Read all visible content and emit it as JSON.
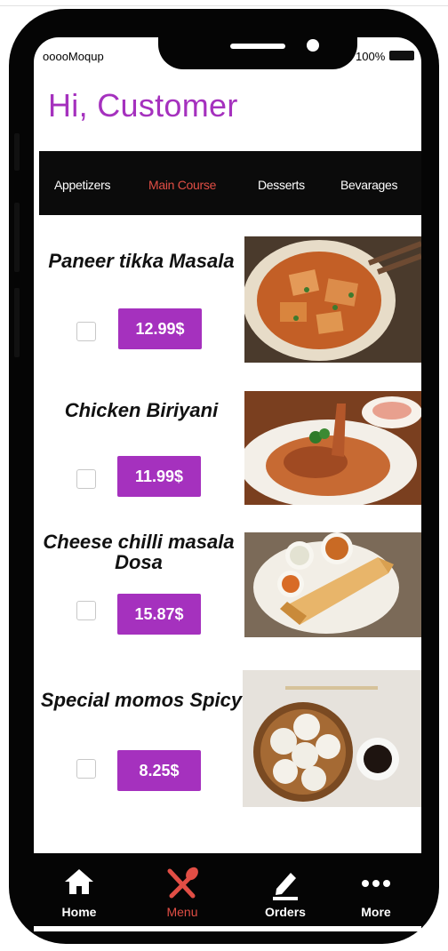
{
  "status_bar": {
    "carrier": "ooooMoqup",
    "battery": "100%"
  },
  "greeting": "Hi, Customer",
  "tabs": [
    {
      "label": "Appetizers",
      "active": false
    },
    {
      "label": "Main Course",
      "active": true
    },
    {
      "label": "Desserts",
      "active": false
    },
    {
      "label": "Bevarages",
      "active": false
    }
  ],
  "menu_items": [
    {
      "name": "Paneer tikka Masala",
      "price": "12.99$",
      "checked": false
    },
    {
      "name": "Chicken Biriyani",
      "price": "11.99$",
      "checked": false
    },
    {
      "name": "Cheese chilli masala Dosa",
      "price": "15.87$",
      "checked": false
    },
    {
      "name": "Special momos Spicy",
      "price": "8.25$",
      "checked": false
    }
  ],
  "bottom_nav": [
    {
      "label": "Home",
      "icon": "home-icon",
      "active": false
    },
    {
      "label": "Menu",
      "icon": "fork-spoon-icon",
      "active": true
    },
    {
      "label": "Orders",
      "icon": "pencil-icon",
      "active": false
    },
    {
      "label": "More",
      "icon": "more-dots-icon",
      "active": false
    }
  ],
  "colors": {
    "accent": "#a531be",
    "active_tab": "#e14e45",
    "tab_bar": "#0b0b0b"
  }
}
